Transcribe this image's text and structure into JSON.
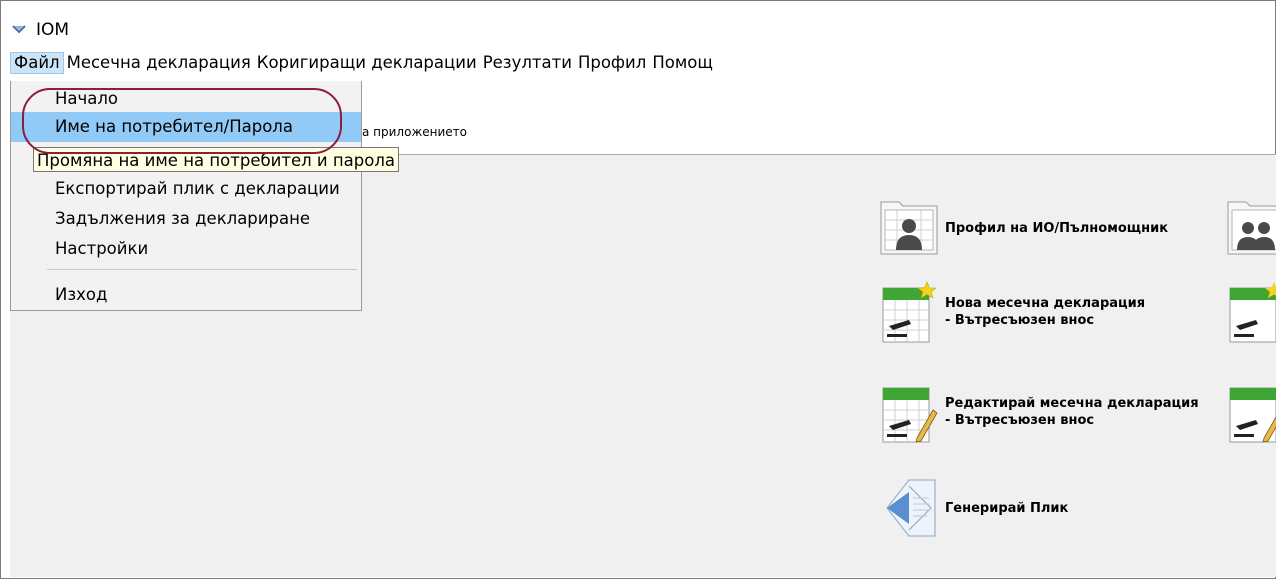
{
  "window": {
    "title": "IOM"
  },
  "menubar": {
    "items": [
      "Файл",
      "Месечна декларация",
      "Коригиращи декларации",
      "Резултати",
      "Профил",
      "Помощ"
    ]
  },
  "file_menu": {
    "items": [
      "Начало",
      "Име на потребител/Парола",
      "Експортирай плик с декларации",
      "Задължения за деклариране",
      "Настройки",
      "Изход"
    ],
    "tooltip": "Промяна на име на потребител и парола"
  },
  "header": {
    "hint_fragment": "а приложението"
  },
  "actions": {
    "profile": "Профил на ИО/Пълномощник",
    "new_decl_line1": "Нова месечна декларация",
    "new_decl_line2": "- Вътресъюзен внос",
    "edit_decl_line1": "Редактирай месечна декларация",
    "edit_decl_line2": "- Вътресъюзен внос",
    "envelope": "Генерирай Плик"
  },
  "colors": {
    "menu_selected": "#91c9f7",
    "tooltip_bg": "#ffffe1",
    "annotation_oval": "#8b1e3f",
    "calendar_green": "#3fa535"
  }
}
